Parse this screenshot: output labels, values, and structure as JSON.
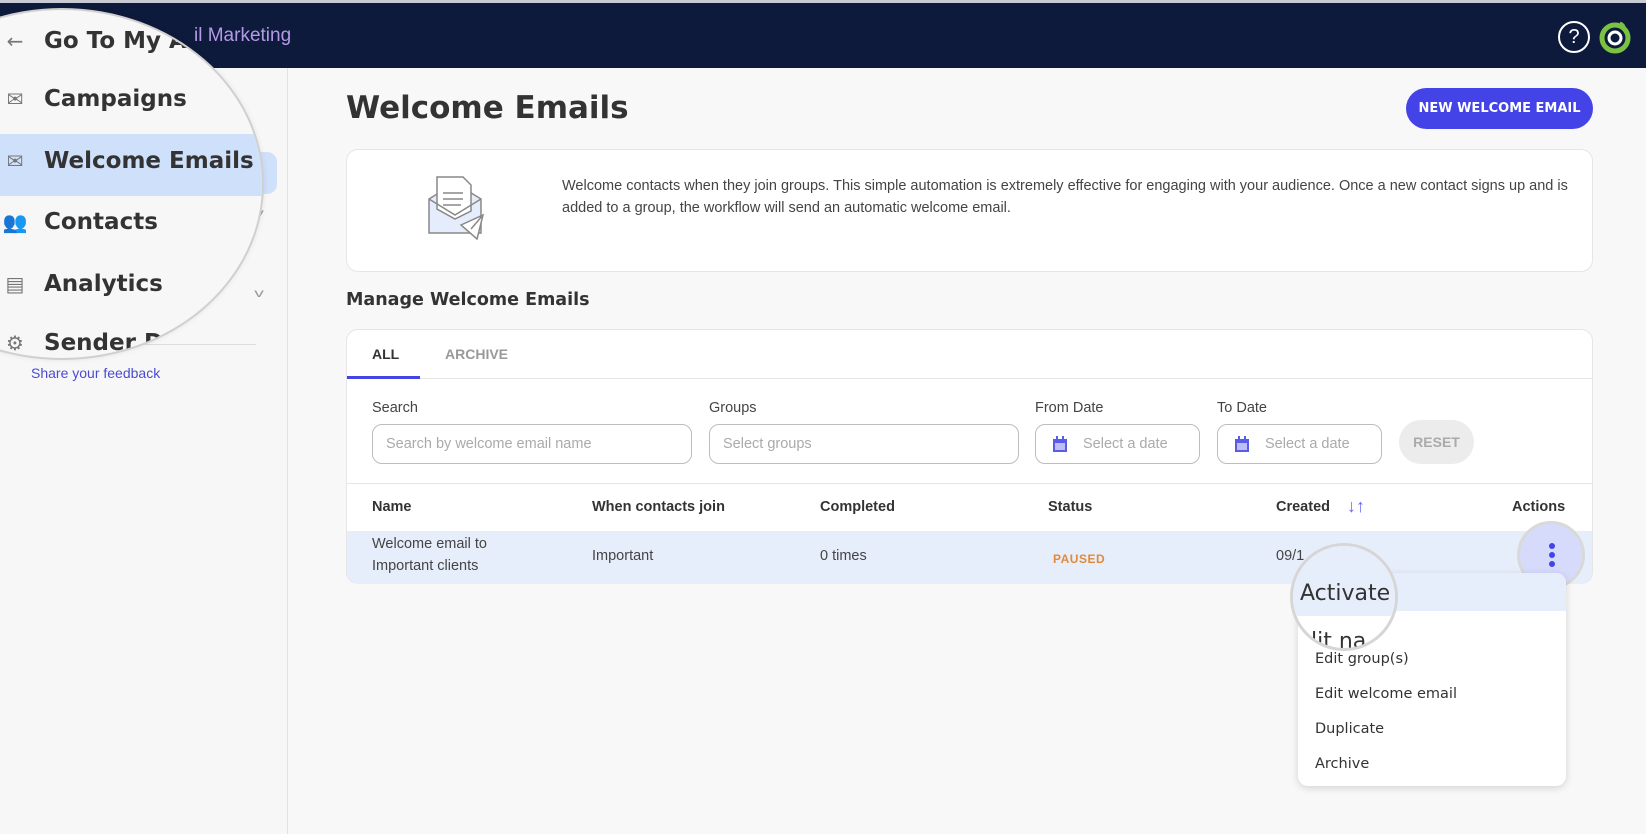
{
  "topbar": {
    "back_label": "Go To My Acuity Email Marketing",
    "back_visible_tail": "il Marketing",
    "help_icon": "?",
    "logo": "sitejet-logo"
  },
  "sidebar": {
    "back_label": "Go To My Ac",
    "items": [
      {
        "label": "Campaigns",
        "icon": "envelope-icon"
      },
      {
        "label": "Welcome Emails",
        "icon": "envelope-check-icon",
        "active": true
      },
      {
        "label": "Contacts",
        "icon": "people-icon"
      },
      {
        "label": "Analytics",
        "icon": "chart-icon"
      },
      {
        "label": "Sender D",
        "icon": "gear-icon"
      }
    ],
    "feedback_link": "Share your feedback"
  },
  "page": {
    "title": "Welcome Emails",
    "new_button": "NEW WELCOME EMAIL",
    "intro_text": "Welcome contacts when they join groups. This simple automation is extremely effective for engaging with your audience. Once a new contact signs up and is added to a group, the workflow will send an automatic welcome email.",
    "section_title": "Manage Welcome Emails"
  },
  "tabs": [
    {
      "label": "ALL",
      "active": true
    },
    {
      "label": "ARCHIVE",
      "active": false
    }
  ],
  "filters": {
    "search_label": "Search",
    "search_placeholder": "Search by welcome email name",
    "groups_label": "Groups",
    "groups_placeholder": "Select groups",
    "from_label": "From Date",
    "from_placeholder": "Select a date",
    "to_label": "To Date",
    "to_placeholder": "Select a date",
    "reset_label": "RESET"
  },
  "table": {
    "columns": [
      "Name",
      "When contacts join",
      "Completed",
      "Status",
      "Created",
      "Actions"
    ],
    "rows": [
      {
        "name_line1": "Welcome email to",
        "name_line2": "Important clients",
        "group": "Important",
        "completed": "0 times",
        "status": "PAUSED",
        "created": "09/1"
      }
    ]
  },
  "colors": {
    "accent": "#4343e8",
    "topbar": "#0d1a3b",
    "status_paused": "#e18a3b",
    "active_nav": "#cfe0fb",
    "row_highlight": "#e7eefb"
  },
  "actions_menu": {
    "items": [
      "Activate",
      "Edit name",
      "Edit group(s)",
      "Edit welcome email",
      "Duplicate",
      "Archive"
    ],
    "magnified_label": "Activate",
    "partial_label": "lit na"
  }
}
